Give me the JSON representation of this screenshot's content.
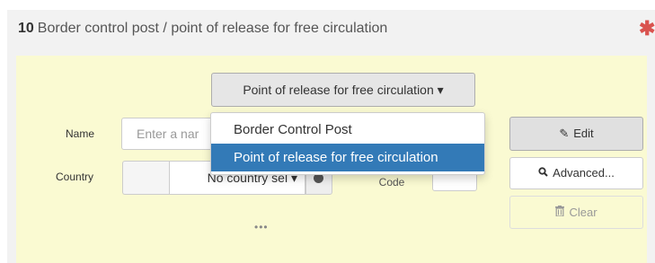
{
  "section": {
    "number": "10",
    "title": "Border control post / point of release for free circulation",
    "required_marker": "✱"
  },
  "type_selector": {
    "selected": "Point of release for free circulation",
    "caret": "▾"
  },
  "dropdown": {
    "options": [
      "Border Control Post",
      "Point of release for free circulation"
    ],
    "selected_index": 1
  },
  "fields": {
    "name_label": "Name",
    "name_placeholder": "Enter a nar",
    "country_label": "Country",
    "country_value": "No country sel",
    "country_caret": "▾",
    "iso_label": "ISO Code",
    "ellipsis": "•••"
  },
  "buttons": {
    "edit": "Edit",
    "advanced": "Advanced...",
    "clear": "Clear"
  },
  "icons": {
    "edit": "edit-icon",
    "advanced": "search-icon",
    "clear": "trash-icon",
    "globe": "globe-icon",
    "required": "asterisk-icon"
  },
  "colors": {
    "panel_background": "#fafad2",
    "selected_option": "#337ab7",
    "required": "#d9534f"
  }
}
